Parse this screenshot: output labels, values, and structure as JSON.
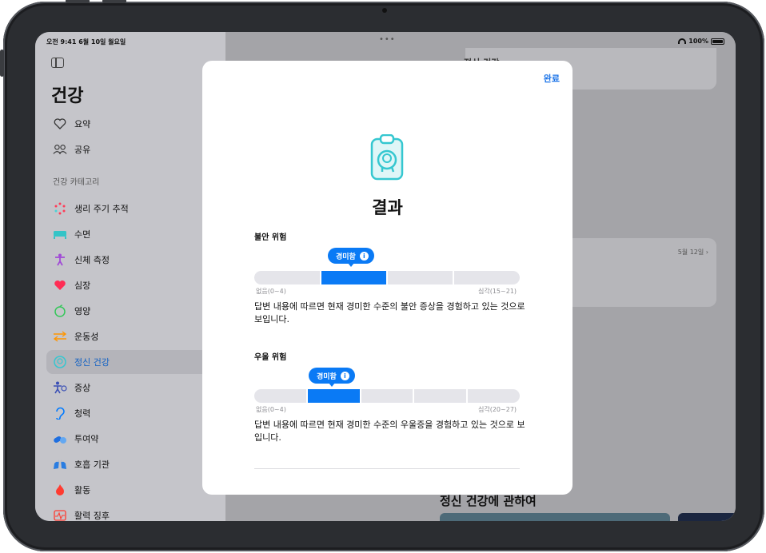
{
  "status_bar": {
    "time_date": "오전 9:41  6월 10일 월요일",
    "dots": "•••",
    "battery": "100%"
  },
  "sidebar": {
    "title": "건강",
    "top_items": [
      {
        "label": "요약",
        "icon": "heart-outline-icon"
      },
      {
        "label": "공유",
        "icon": "people-icon"
      }
    ],
    "section_label": "건강 카테고리",
    "categories": [
      {
        "label": "생리 주기 추적",
        "icon": "cycle-tracking-icon",
        "color": "#ff3b57"
      },
      {
        "label": "수면",
        "icon": "bed-icon",
        "color": "#34c4c7"
      },
      {
        "label": "신체 측정",
        "icon": "body-icon",
        "color": "#a14bd6"
      },
      {
        "label": "심장",
        "icon": "heart-icon",
        "color": "#ff2d55"
      },
      {
        "label": "영양",
        "icon": "apple-icon",
        "color": "#34c759"
      },
      {
        "label": "운동성",
        "icon": "arrows-icon",
        "color": "#ff9500"
      },
      {
        "label": "정신 건강",
        "icon": "brain-head-icon",
        "color": "#35c7d0",
        "active": true
      },
      {
        "label": "증상",
        "icon": "symptoms-icon",
        "color": "#3a4fb5"
      },
      {
        "label": "청력",
        "icon": "ear-icon",
        "color": "#007aff"
      },
      {
        "label": "투여약",
        "icon": "pills-icon",
        "color": "#1f6fe0"
      },
      {
        "label": "호흡 기관",
        "icon": "lungs-icon",
        "color": "#2a7de1"
      },
      {
        "label": "활동",
        "icon": "flame-icon",
        "color": "#ff3b30"
      },
      {
        "label": "활력 징후",
        "icon": "vitals-icon",
        "color": "#ff3b30"
      }
    ]
  },
  "main": {
    "header_title": "정신 건강",
    "card_date": "5월 12일",
    "about_title": "정신 건강에 관하여"
  },
  "sheet": {
    "done_label": "완료",
    "title": "결과",
    "anxiety": {
      "label": "불안 위험",
      "level_label": "경미함",
      "min_label": "없음(0~4)",
      "max_label": "심각(15~21)",
      "segments": 4,
      "active_segment": 1,
      "description": "답변 내용에 따르면 현재 경미한 수준의 불안 증상을 경험하고 있는 것으로 보입니다."
    },
    "depression": {
      "label": "우울 위험",
      "level_label": "경미함",
      "min_label": "없음(0~4)",
      "max_label": "심각(20~27)",
      "segments": 5,
      "active_segment": 1,
      "description": "답변 내용에 따르면 현재 경미한 수준의 우울증을 경험하고 있는 것으로 보입니다."
    }
  }
}
